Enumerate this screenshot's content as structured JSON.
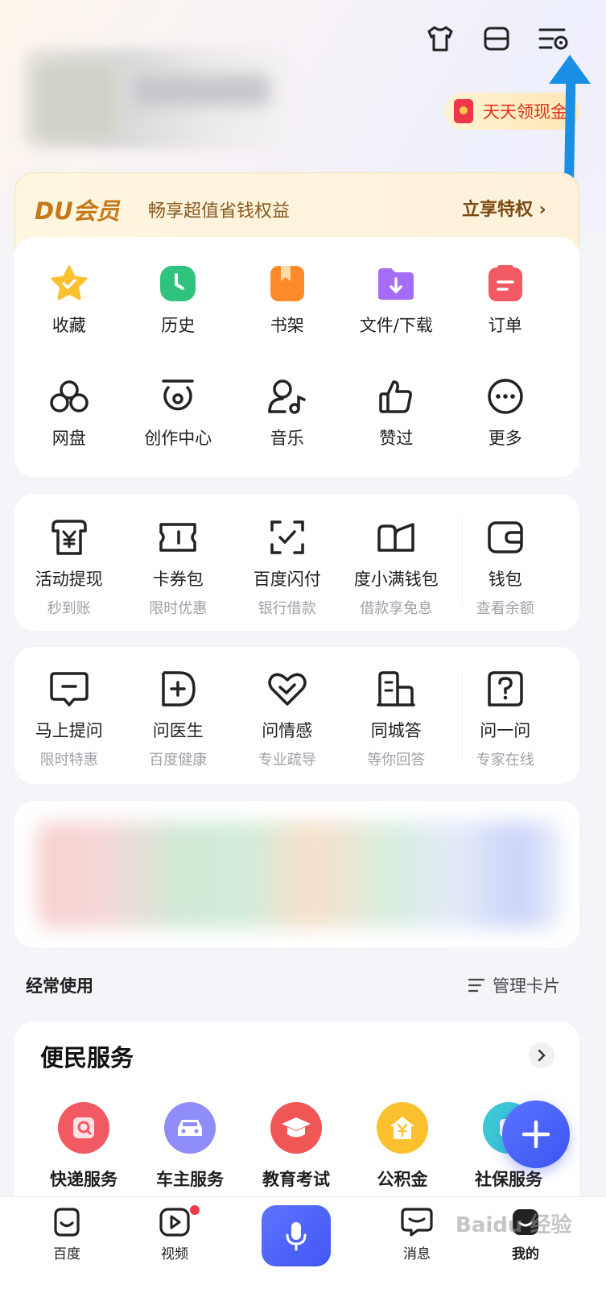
{
  "header": {
    "cash_label": "天天领现金",
    "icons": [
      "tshirt-icon",
      "scan-icon",
      "settings-menu-icon"
    ]
  },
  "du_member": {
    "logo": "DU会员",
    "tagline": "畅享超值省钱权益",
    "action": "立享特权 ›"
  },
  "shortcuts": {
    "row1": [
      {
        "label": "收藏",
        "icon": "star-icon",
        "color": "#fdc02f"
      },
      {
        "label": "历史",
        "icon": "clock-icon",
        "color": "#2fc37d"
      },
      {
        "label": "书架",
        "icon": "bookshelf-icon",
        "color": "#ff8a2a"
      },
      {
        "label": "文件/下载",
        "icon": "download-folder-icon",
        "color": "#a56df5"
      },
      {
        "label": "订单",
        "icon": "order-icon",
        "color": "#f25a63"
      }
    ],
    "row2": [
      {
        "label": "网盘",
        "icon": "cloud-drive-icon"
      },
      {
        "label": "创作中心",
        "icon": "creator-icon"
      },
      {
        "label": "音乐",
        "icon": "music-icon"
      },
      {
        "label": "赞过",
        "icon": "thumbs-up-icon"
      },
      {
        "label": "更多",
        "icon": "more-icon"
      }
    ]
  },
  "finance": [
    {
      "label": "活动提现",
      "sub": "秒到账",
      "icon": "cash-withdraw-icon"
    },
    {
      "label": "卡券包",
      "sub": "限时优惠",
      "icon": "coupon-icon"
    },
    {
      "label": "百度闪付",
      "sub": "银行借款",
      "icon": "quick-pay-icon"
    },
    {
      "label": "度小满钱包",
      "sub": "借款享免息",
      "icon": "dxm-wallet-icon"
    },
    {
      "label": "钱包",
      "sub": "查看余额",
      "icon": "wallet-icon"
    }
  ],
  "ask": [
    {
      "label": "马上提问",
      "sub": "限时特惠",
      "icon": "ask-bubble-icon"
    },
    {
      "label": "问医生",
      "sub": "百度健康",
      "icon": "doctor-icon"
    },
    {
      "label": "问情感",
      "sub": "专业疏导",
      "icon": "heart-icon"
    },
    {
      "label": "同城答",
      "sub": "等你回答",
      "icon": "building-icon"
    },
    {
      "label": "问一问",
      "sub": "专家在线",
      "icon": "question-icon"
    }
  ],
  "frequent": {
    "title": "经常使用",
    "manage": "管理卡片"
  },
  "services": {
    "title": "便民服务",
    "items": [
      {
        "label": "快递服务",
        "icon": "express-icon",
        "color": "#f25a63"
      },
      {
        "label": "车主服务",
        "icon": "car-icon",
        "color": "#8f8df7"
      },
      {
        "label": "教育考试",
        "icon": "graduation-cap-icon",
        "color": "#ef5656"
      },
      {
        "label": "公积金",
        "icon": "housing-fund-icon",
        "color": "#fbc02d"
      },
      {
        "label": "社保服务",
        "icon": "social-security-icon",
        "color": "#3cc7d6"
      }
    ]
  },
  "tabbar": {
    "items": [
      {
        "label": "百度",
        "icon": "baidu-home-icon"
      },
      {
        "label": "视频",
        "icon": "video-icon"
      },
      {
        "label": "",
        "icon": "mic-icon"
      },
      {
        "label": "消息",
        "icon": "message-icon"
      },
      {
        "label": "我的",
        "icon": "profile-icon"
      }
    ]
  },
  "watermark": "Baidu 经验"
}
